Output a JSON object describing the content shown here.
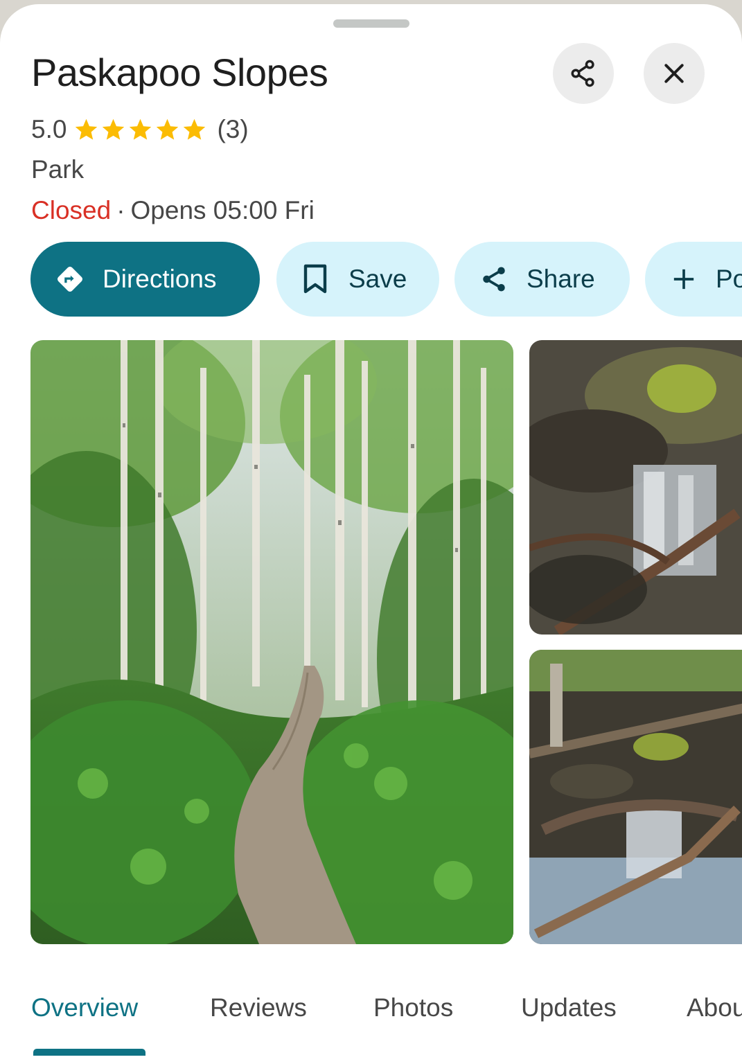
{
  "place": {
    "name": "Paskapoo Slopes",
    "rating": "5.0",
    "stars": 5,
    "review_count": "(3)",
    "category": "Park",
    "status": "Closed",
    "separator": "·",
    "hours": "Opens 05:00 Fri"
  },
  "header_buttons": {
    "share_icon": "share-icon",
    "close_icon": "close-icon"
  },
  "actions": [
    {
      "label": "Directions",
      "icon": "directions-icon"
    },
    {
      "label": "Save",
      "icon": "bookmark-icon"
    },
    {
      "label": "Share",
      "icon": "share-icon"
    },
    {
      "label": "Po",
      "icon": "plus-icon"
    }
  ],
  "tabs": [
    {
      "label": "Overview",
      "active": true
    },
    {
      "label": "Reviews"
    },
    {
      "label": "Photos"
    },
    {
      "label": "Updates"
    },
    {
      "label": "Abou"
    }
  ],
  "colors": {
    "accent": "#0e7284",
    "chip_bg": "#d6f3fb",
    "closed": "#d93025",
    "star": "#fbbc04"
  }
}
